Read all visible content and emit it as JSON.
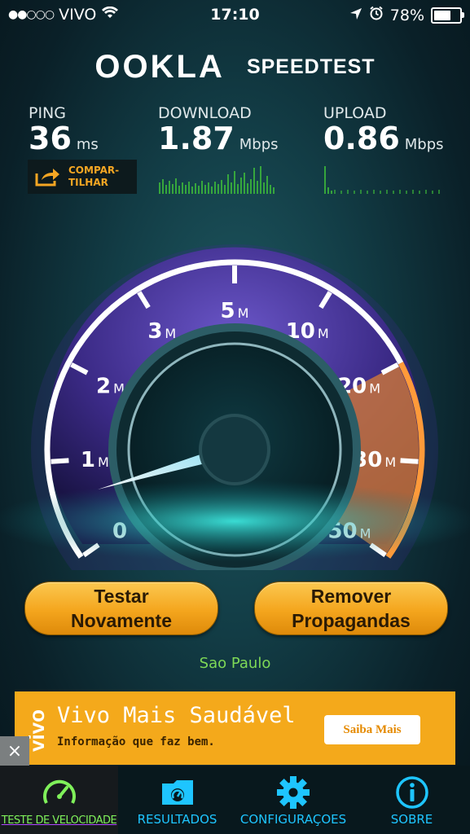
{
  "status_bar": {
    "carrier": "VIVO",
    "time": "17:10",
    "battery": "78%",
    "battery_level": 0.78
  },
  "header": {
    "logo": "OOKLA",
    "product": "SPEEDTEST"
  },
  "metrics": {
    "ping": {
      "label": "PING",
      "value": "36",
      "unit": "ms"
    },
    "download": {
      "label": "DOWNLOAD",
      "value": "1.87",
      "unit": "Mbps"
    },
    "upload": {
      "label": "UPLOAD",
      "value": "0.86",
      "unit": "Mbps"
    }
  },
  "share": {
    "line1": "COMPAR-",
    "line2": "TILHAR"
  },
  "gauge": {
    "ticks": [
      {
        "num": "0",
        "suffix": ""
      },
      {
        "num": "1",
        "suffix": "M"
      },
      {
        "num": "2",
        "suffix": "M"
      },
      {
        "num": "3",
        "suffix": "M"
      },
      {
        "num": "5",
        "suffix": "M"
      },
      {
        "num": "10",
        "suffix": "M"
      },
      {
        "num": "20",
        "suffix": "M"
      },
      {
        "num": "30",
        "suffix": "M"
      },
      {
        "num": "50",
        "suffix": "M"
      }
    ],
    "needle_value_mbps": 0.6
  },
  "buttons": {
    "test_again": {
      "line1": "Testar",
      "line2": "Novamente"
    },
    "remove_ads": {
      "line1": "Remover",
      "line2": "Propagandas"
    }
  },
  "server": "Sao Paulo",
  "ad": {
    "brand": "vivo",
    "headline": "Vivo Mais Saudável",
    "subline": "Informação que faz bem.",
    "cta": "Saiba Mais",
    "close": "×"
  },
  "tabs": [
    {
      "label": "TESTE DE VELOCIDADE",
      "icon": "speedometer-icon"
    },
    {
      "label": "RESULTADOS",
      "icon": "results-folder-icon"
    },
    {
      "label": "CONFIGURAÇOES",
      "icon": "gear-icon"
    },
    {
      "label": "SOBRE",
      "icon": "info-icon"
    }
  ],
  "colors": {
    "accent_orange": "#f4a51d",
    "gauge_purple": "#5a3fb0",
    "speed_green": "#7ff05a",
    "tab_blue": "#1ec5ff"
  }
}
